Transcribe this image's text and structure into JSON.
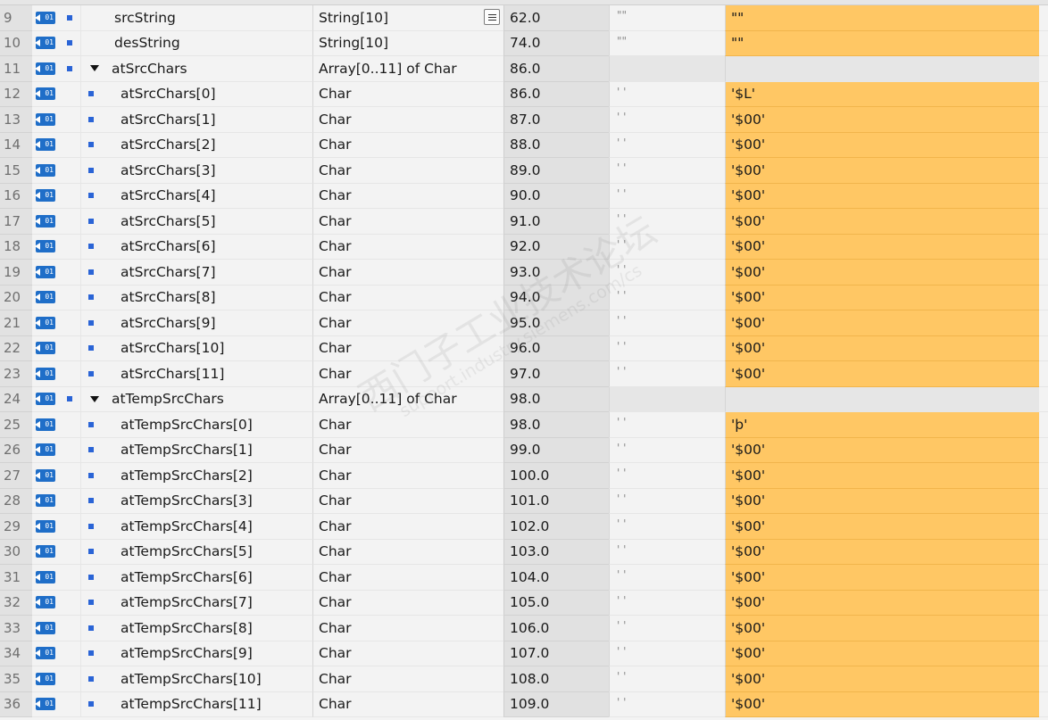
{
  "watermark": {
    "line1": "西门子工业技术论坛",
    "line2": "support.industry.siemens.com/cs"
  },
  "colors": {
    "monitor_value_bg": "#ffc764",
    "db_icon": "#1f6ec8",
    "member_square": "#2a64d6"
  },
  "rows": [
    {
      "num": "9",
      "name": "srcString",
      "type": "String[10]",
      "offset": "62.0",
      "start": "\"\"",
      "monitor": "\"\"",
      "level": 0,
      "tree": false,
      "list_button": true
    },
    {
      "num": "10",
      "name": "desString",
      "type": "String[10]",
      "offset": "74.0",
      "start": "\"\"",
      "monitor": "\"\"",
      "level": 0,
      "tree": false
    },
    {
      "num": "11",
      "name": "atSrcChars",
      "type": "Array[0..11] of Char",
      "offset": "86.0",
      "start": "",
      "monitor": "",
      "level": 0,
      "tree": true
    },
    {
      "num": "12",
      "name": "atSrcChars[0]",
      "type": "Char",
      "offset": "86.0",
      "start": "' '",
      "monitor": "'$L'",
      "level": 1
    },
    {
      "num": "13",
      "name": "atSrcChars[1]",
      "type": "Char",
      "offset": "87.0",
      "start": "' '",
      "monitor": "'$00'",
      "level": 1
    },
    {
      "num": "14",
      "name": "atSrcChars[2]",
      "type": "Char",
      "offset": "88.0",
      "start": "' '",
      "monitor": "'$00'",
      "level": 1
    },
    {
      "num": "15",
      "name": "atSrcChars[3]",
      "type": "Char",
      "offset": "89.0",
      "start": "' '",
      "monitor": "'$00'",
      "level": 1
    },
    {
      "num": "16",
      "name": "atSrcChars[4]",
      "type": "Char",
      "offset": "90.0",
      "start": "' '",
      "monitor": "'$00'",
      "level": 1
    },
    {
      "num": "17",
      "name": "atSrcChars[5]",
      "type": "Char",
      "offset": "91.0",
      "start": "' '",
      "monitor": "'$00'",
      "level": 1
    },
    {
      "num": "18",
      "name": "atSrcChars[6]",
      "type": "Char",
      "offset": "92.0",
      "start": "' '",
      "monitor": "'$00'",
      "level": 1
    },
    {
      "num": "19",
      "name": "atSrcChars[7]",
      "type": "Char",
      "offset": "93.0",
      "start": "' '",
      "monitor": "'$00'",
      "level": 1
    },
    {
      "num": "20",
      "name": "atSrcChars[8]",
      "type": "Char",
      "offset": "94.0",
      "start": "' '",
      "monitor": "'$00'",
      "level": 1
    },
    {
      "num": "21",
      "name": "atSrcChars[9]",
      "type": "Char",
      "offset": "95.0",
      "start": "' '",
      "monitor": "'$00'",
      "level": 1
    },
    {
      "num": "22",
      "name": "atSrcChars[10]",
      "type": "Char",
      "offset": "96.0",
      "start": "' '",
      "monitor": "'$00'",
      "level": 1
    },
    {
      "num": "23",
      "name": "atSrcChars[11]",
      "type": "Char",
      "offset": "97.0",
      "start": "' '",
      "monitor": "'$00'",
      "level": 1
    },
    {
      "num": "24",
      "name": "atTempSrcChars",
      "type": "Array[0..11] of Char",
      "offset": "98.0",
      "start": "",
      "monitor": "",
      "level": 0,
      "tree": true
    },
    {
      "num": "25",
      "name": "atTempSrcChars[0]",
      "type": "Char",
      "offset": "98.0",
      "start": "' '",
      "monitor": "'þ'",
      "level": 1
    },
    {
      "num": "26",
      "name": "atTempSrcChars[1]",
      "type": "Char",
      "offset": "99.0",
      "start": "' '",
      "monitor": "'$00'",
      "level": 1
    },
    {
      "num": "27",
      "name": "atTempSrcChars[2]",
      "type": "Char",
      "offset": "100.0",
      "start": "' '",
      "monitor": "'$00'",
      "level": 1
    },
    {
      "num": "28",
      "name": "atTempSrcChars[3]",
      "type": "Char",
      "offset": "101.0",
      "start": "' '",
      "monitor": "'$00'",
      "level": 1
    },
    {
      "num": "29",
      "name": "atTempSrcChars[4]",
      "type": "Char",
      "offset": "102.0",
      "start": "' '",
      "monitor": "'$00'",
      "level": 1
    },
    {
      "num": "30",
      "name": "atTempSrcChars[5]",
      "type": "Char",
      "offset": "103.0",
      "start": "' '",
      "monitor": "'$00'",
      "level": 1
    },
    {
      "num": "31",
      "name": "atTempSrcChars[6]",
      "type": "Char",
      "offset": "104.0",
      "start": "' '",
      "monitor": "'$00'",
      "level": 1
    },
    {
      "num": "32",
      "name": "atTempSrcChars[7]",
      "type": "Char",
      "offset": "105.0",
      "start": "' '",
      "monitor": "'$00'",
      "level": 1
    },
    {
      "num": "33",
      "name": "atTempSrcChars[8]",
      "type": "Char",
      "offset": "106.0",
      "start": "' '",
      "monitor": "'$00'",
      "level": 1
    },
    {
      "num": "34",
      "name": "atTempSrcChars[9]",
      "type": "Char",
      "offset": "107.0",
      "start": "' '",
      "monitor": "'$00'",
      "level": 1
    },
    {
      "num": "35",
      "name": "atTempSrcChars[10]",
      "type": "Char",
      "offset": "108.0",
      "start": "' '",
      "monitor": "'$00'",
      "level": 1
    },
    {
      "num": "36",
      "name": "atTempSrcChars[11]",
      "type": "Char",
      "offset": "109.0",
      "start": "' '",
      "monitor": "'$00'",
      "level": 1
    }
  ]
}
